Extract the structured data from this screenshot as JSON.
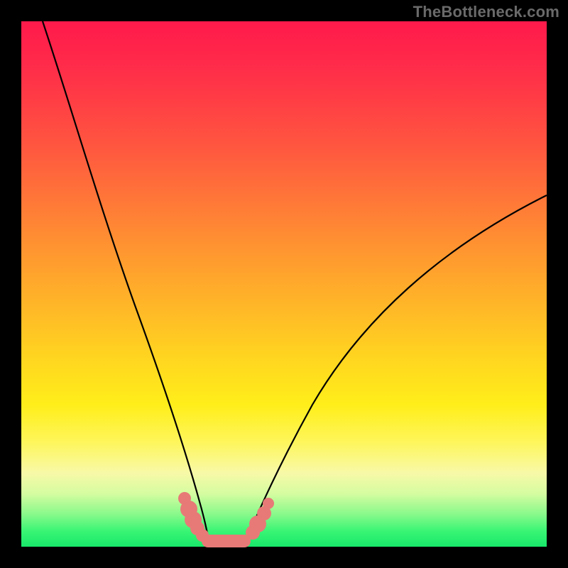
{
  "watermark": "TheBottleneck.com",
  "colors": {
    "frame": "#000000",
    "gradient_top": "#ff1a4b",
    "gradient_bottom": "#18e86a",
    "curve": "#000000",
    "marker": "#e77a77"
  },
  "chart_data": {
    "type": "line",
    "title": "",
    "xlabel": "",
    "ylabel": "",
    "xlim": [
      0,
      100
    ],
    "ylim": [
      0,
      100
    ],
    "grid": false,
    "legend": false,
    "series": [
      {
        "name": "left-branch",
        "x": [
          4,
          8,
          12,
          16,
          20,
          24,
          28,
          30,
          32,
          34,
          35
        ],
        "y": [
          100,
          82,
          65,
          50,
          37,
          25,
          15,
          10,
          6,
          3,
          1
        ]
      },
      {
        "name": "right-branch",
        "x": [
          43,
          45,
          48,
          52,
          58,
          66,
          76,
          88,
          100
        ],
        "y": [
          1,
          4,
          8,
          14,
          22,
          32,
          44,
          56,
          67
        ]
      },
      {
        "name": "valley-floor",
        "x": [
          35,
          37,
          39,
          41,
          43
        ],
        "y": [
          1,
          0.5,
          0.5,
          0.5,
          1
        ]
      }
    ],
    "markers": [
      {
        "x": 31.0,
        "y": 9.0,
        "r": 1.2
      },
      {
        "x": 31.8,
        "y": 7.0,
        "r": 1.6
      },
      {
        "x": 32.6,
        "y": 5.1,
        "r": 1.6
      },
      {
        "x": 33.4,
        "y": 3.5,
        "r": 1.4
      },
      {
        "x": 34.4,
        "y": 2.0,
        "r": 1.3
      },
      {
        "x": 44.0,
        "y": 2.5,
        "r": 1.4
      },
      {
        "x": 45.0,
        "y": 4.3,
        "r": 1.6
      },
      {
        "x": 46.2,
        "y": 6.3,
        "r": 1.4
      },
      {
        "x": 47.0,
        "y": 8.2,
        "r": 1.1
      }
    ],
    "valley_bar": {
      "x1": 35.5,
      "x2": 42.5,
      "y": 0.9
    }
  }
}
